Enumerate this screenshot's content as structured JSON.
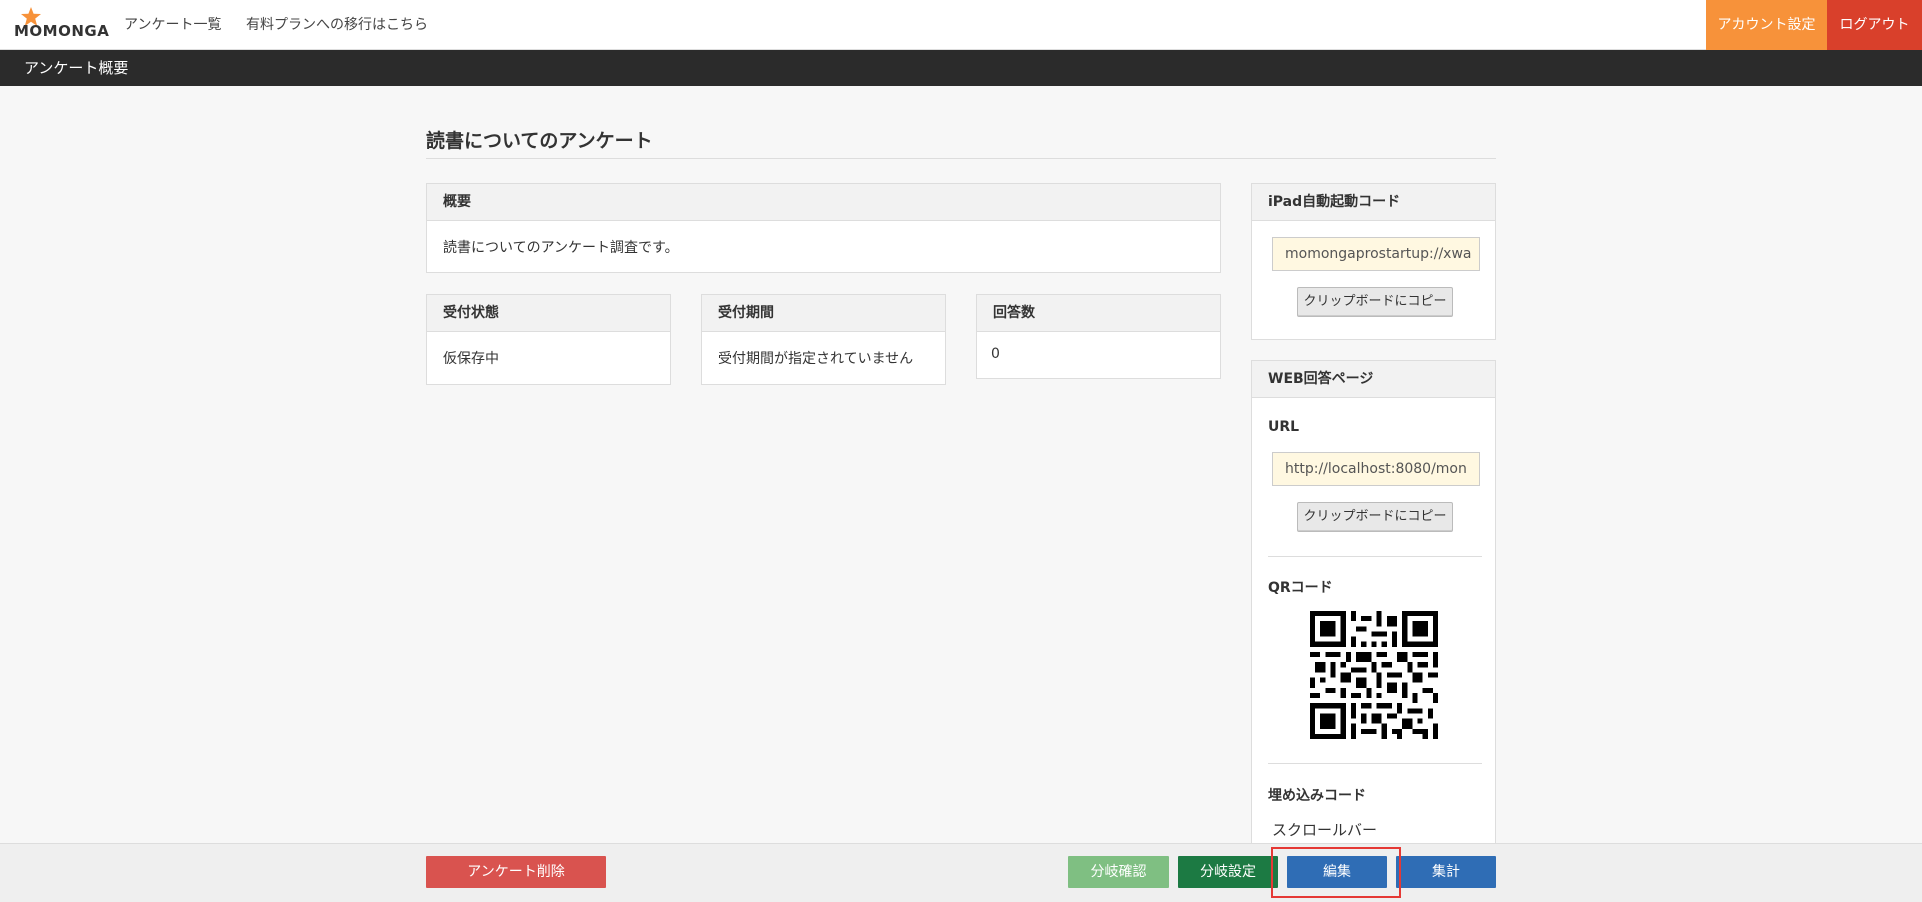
{
  "app": {
    "logo_text": "MOMONGA"
  },
  "nav": {
    "links": [
      "アンケート一覧",
      "有料プランへの移行はこちら"
    ],
    "account_label": "アカウント設定",
    "logout_label": "ログアウト"
  },
  "subheader": {
    "title": "アンケート概要"
  },
  "survey": {
    "title": "読書についてのアンケート",
    "overview_head": "概要",
    "overview_text": "読書についてのアンケート調査です。",
    "status_head": "受付状態",
    "status_value": "仮保存中",
    "period_head": "受付期間",
    "period_value": "受付期間が指定されていません",
    "responses_head": "回答数",
    "responses_value": "0"
  },
  "sidebar": {
    "ipad_head": "iPad自動起動コード",
    "ipad_value": "momongaprostartup://xwa",
    "copy_label": "クリップボードにコピー",
    "web_head": "WEB回答ページ",
    "url_label": "URL",
    "url_value": "http://localhost:8080/mon",
    "qr_label": "QRコード",
    "embed_label": "埋め込みコード",
    "scroll_label": "スクロールバー"
  },
  "actions": {
    "delete_label": "アンケート削除",
    "branch_check_label": "分岐確認",
    "branch_set_label": "分岐設定",
    "edit_label": "編集",
    "aggregate_label": "集計"
  },
  "colors": {
    "account": "#f7923a",
    "logout": "#d9402b",
    "delete": "#d9534f",
    "branch_check": "#7fbf82",
    "branch_set": "#1c7a43",
    "primary": "#2f6db5",
    "highlight": "#e53935"
  }
}
